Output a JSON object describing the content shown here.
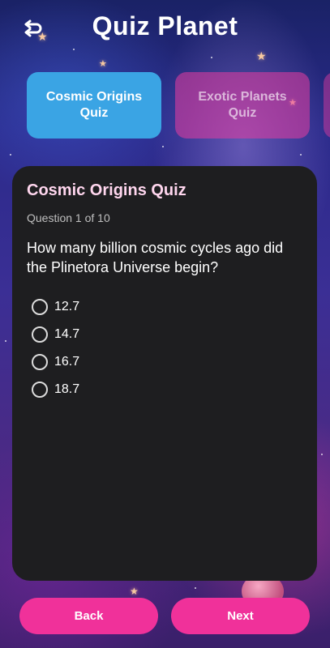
{
  "header": {
    "title": "Quiz Planet",
    "back_icon": "back-arrow-icon"
  },
  "tabs": [
    {
      "label": "Cosmic Origins Quiz",
      "active": true
    },
    {
      "label": "Exotic Planets Quiz",
      "active": false
    }
  ],
  "quiz": {
    "title": "Cosmic Origins Quiz",
    "progress": "Question 1 of 10",
    "question": "How many billion cosmic cycles ago did the Plinetora Universe begin?",
    "options": [
      "12.7",
      "14.7",
      "16.7",
      "18.7"
    ]
  },
  "footer": {
    "back_label": "Back",
    "next_label": "Next"
  },
  "colors": {
    "accent_pink": "#f0319a",
    "active_tab_blue": "#3aa4e4",
    "card_bg": "#1e1e20",
    "card_title": "#ffd6ee"
  }
}
